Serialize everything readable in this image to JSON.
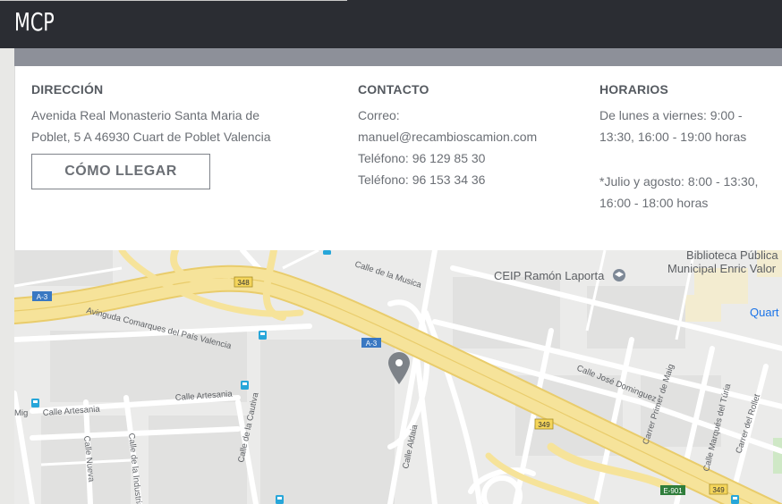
{
  "header": {
    "brand": "MCP"
  },
  "info": {
    "direccion": {
      "heading": "DIRECCIÓN",
      "lines": [
        "Avenida Real Monasterio Santa Maria de",
        "Poblet, 5 A 46930 Cuart de Poblet Valencia"
      ],
      "button_label": "CÓMO LLEGAR"
    },
    "contacto": {
      "heading": "CONTACTO",
      "lines": [
        "Correo:",
        "manuel@recambioscamion.com",
        "Teléfono: 96 129 85 30",
        "Teléfono: 96 153 34 36"
      ]
    },
    "horarios": {
      "heading": "HORARIOS",
      "lines": [
        "De lunes a viernes: 9:00 -",
        "13:30, 16:00 - 19:00 horas",
        "",
        "*Julio y agosto: 8:00 - 13:30,",
        "16:00 - 18:00 horas"
      ]
    }
  },
  "map": {
    "labels": {
      "calle_musica": "Calle de la Musica",
      "avinguda": "Avinguda Comarques del País Valencia",
      "calle_artesania_1": "Calle Artesania",
      "calle_artesania_2": "Calle Artesania",
      "mig": "Mig",
      "calle_nueva": "Calle Nueva",
      "calle_industria": "Calle de la Industria",
      "calle_cautiva": "Calle de la Cautiva",
      "calle_aldaia": "Calle Aldaia",
      "calle_jose": "Calle José Dominguez",
      "carrer_primer": "Carrer Primer de Maig",
      "calle_marques": "Calle Marqués del Túria",
      "carrer_rollet": "Carrer del Rollet",
      "ceip": "CEIP Ramón Laporta",
      "biblioteca_1": "Biblioteca Pública",
      "biblioteca_2": "Municipal Enric Valor",
      "quart": "Quart"
    },
    "shields": {
      "a3_left": "A-3",
      "a3_center": "A-3",
      "r348": "348",
      "r349_a": "349",
      "r349_b": "349",
      "e901": "E-901"
    },
    "icons": [
      "map-pin-icon",
      "school-icon",
      "bus-stop-icon"
    ],
    "colors": {
      "highway": "#f6e39a",
      "highway_edge": "#e9cc6b",
      "road": "#ffffff",
      "block": "#ebebea",
      "pin": "#7d8288",
      "poi": "#1a73e8"
    }
  }
}
